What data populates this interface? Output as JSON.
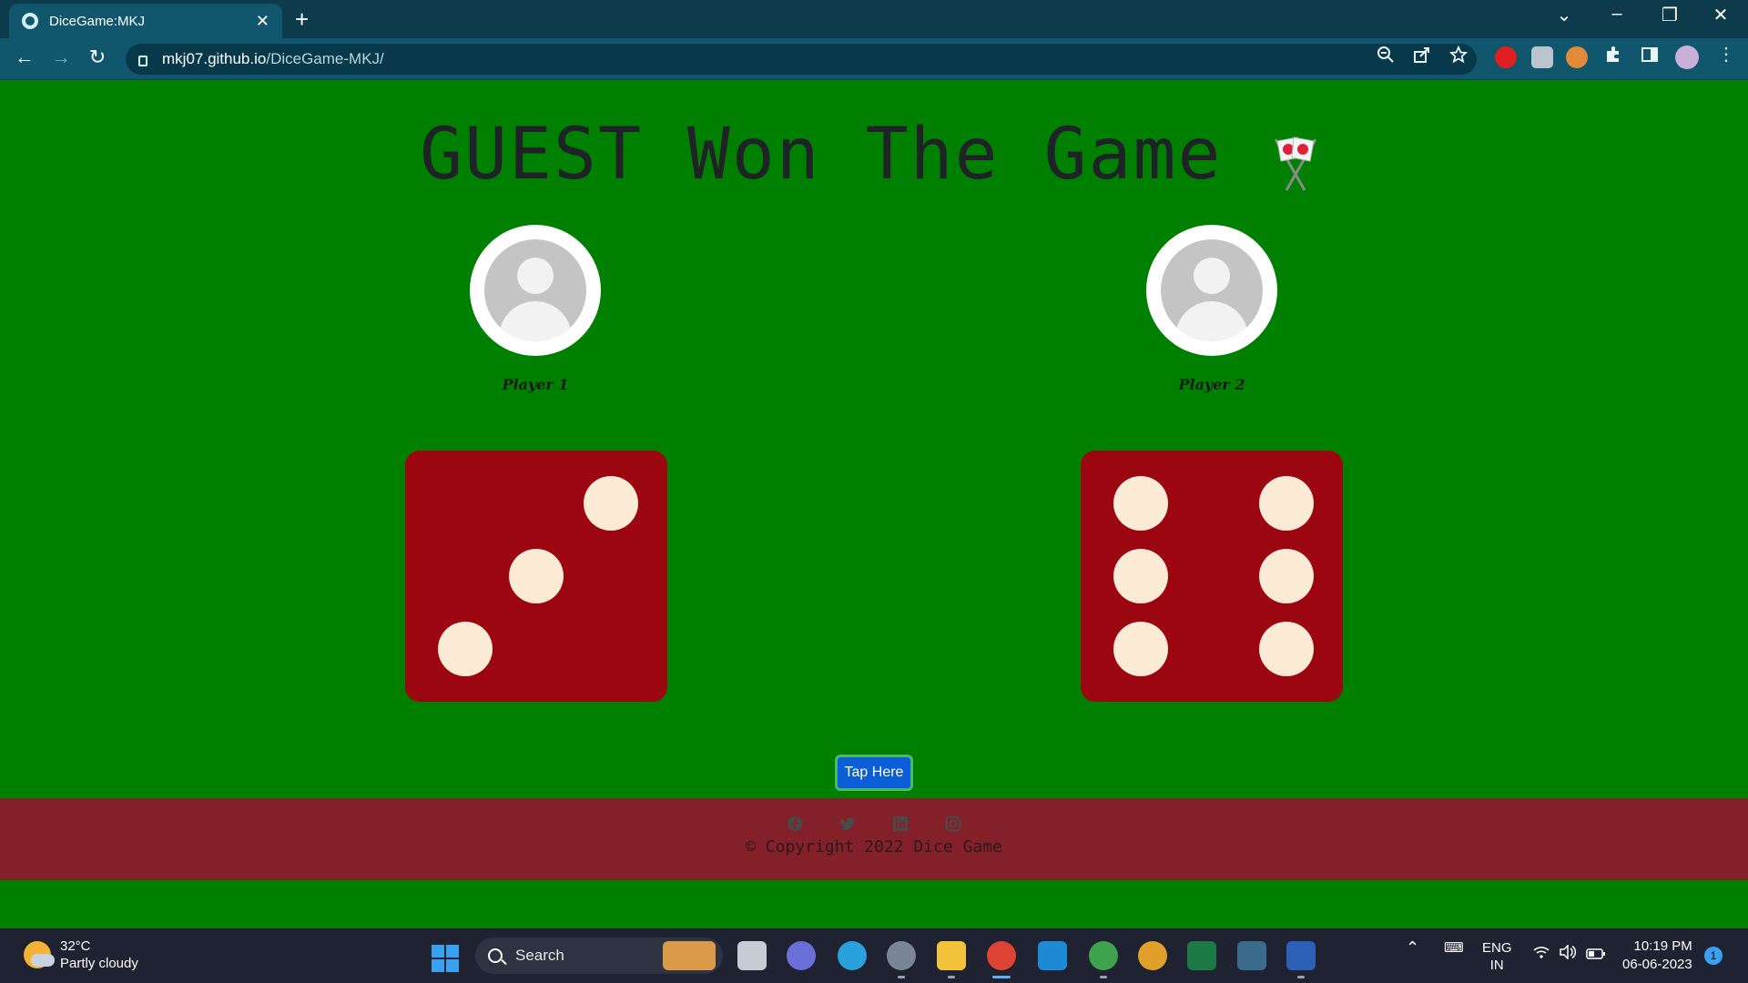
{
  "browser": {
    "tab_title": "DiceGame:MKJ",
    "url_host": "mkj07.github.io",
    "url_path": "/DiceGame-MKJ/"
  },
  "page": {
    "heading": "GUEST Won The Game",
    "players": [
      {
        "name": "Player 1",
        "die_value": 3
      },
      {
        "name": "Player 2",
        "die_value": 6
      }
    ],
    "button_label": "Tap Here",
    "footer": {
      "social_icons": [
        "facebook-icon",
        "twitter-icon",
        "linkedin-icon",
        "instagram-icon"
      ],
      "copyright": "© Copyright 2022 Dice Game"
    }
  },
  "taskbar": {
    "temperature": "32°C",
    "weather": "Partly cloudy",
    "search_label": "Search",
    "language_top": "ENG",
    "language_bottom": "IN",
    "time": "10:19 PM",
    "date": "06-06-2023",
    "notification_count": "1"
  },
  "colors": {
    "page_bg": "#008000",
    "die": "#9b0610",
    "pip": "#fbebd4",
    "footer_bg": "#842029",
    "button": "#0b5ed7"
  }
}
